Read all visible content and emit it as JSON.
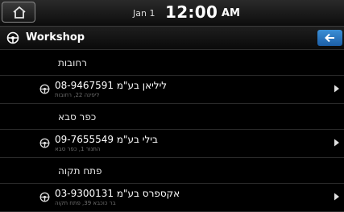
{
  "status": {
    "date": "Jan 1",
    "time": "12:00",
    "ampm": "AM"
  },
  "header": {
    "title": "Workshop"
  },
  "groups": [
    {
      "city": "רחובות",
      "item": {
        "name": "08-9467591 ליליאן בע\"מ",
        "address": "ליפינה 22, רחובות"
      }
    },
    {
      "city": "כפר סבא",
      "item": {
        "name": "09-7655549 בילי בע\"מ",
        "address": "התנור 1, כפר סבא"
      }
    },
    {
      "city": "פתח תקוה",
      "item": {
        "name": "03-9300131 אקספרס בע\"מ",
        "address": "בר כוכבא 39, פתח תקוה"
      }
    }
  ],
  "icons": {
    "home": "home-icon",
    "title": "steering-wheel-icon",
    "back": "back-arrow-icon",
    "poi": "steering-wheel-icon",
    "arrow": "chevron-right-icon"
  },
  "colors": {
    "accent": "#2a7fcf",
    "background": "#000000"
  }
}
